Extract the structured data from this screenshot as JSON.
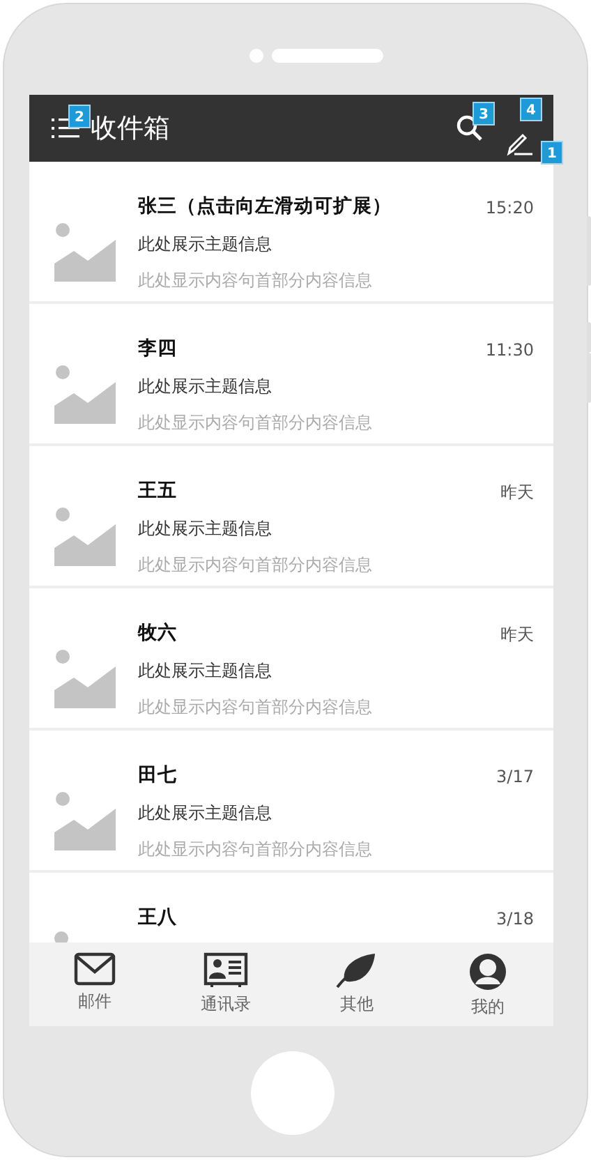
{
  "header": {
    "title": "收件箱"
  },
  "annotations": [
    "1",
    "2",
    "3",
    "4"
  ],
  "messages": [
    {
      "name": "张三（点击向左滑动可扩展）",
      "time": "15:20",
      "subject": "此处展示主题信息",
      "preview": "此处显示内容句首部分内容信息"
    },
    {
      "name": "李四",
      "time": "11:30",
      "subject": "此处展示主题信息",
      "preview": "此处显示内容句首部分内容信息"
    },
    {
      "name": "王五",
      "time": "昨天",
      "subject": "此处展示主题信息",
      "preview": "此处显示内容句首部分内容信息"
    },
    {
      "name": "牧六",
      "time": "昨天",
      "subject": "此处展示主题信息",
      "preview": "此处显示内容句首部分内容信息"
    },
    {
      "name": "田七",
      "time": "3/17",
      "subject": "此处展示主题信息",
      "preview": "此处显示内容句首部分内容信息"
    },
    {
      "name": "王八",
      "time": "3/18"
    }
  ],
  "tabs": [
    {
      "label": "邮件",
      "kind": "mail"
    },
    {
      "label": "通讯录",
      "kind": "contacts"
    },
    {
      "label": "其他",
      "kind": "leaf"
    },
    {
      "label": "我的",
      "kind": "profile"
    }
  ]
}
